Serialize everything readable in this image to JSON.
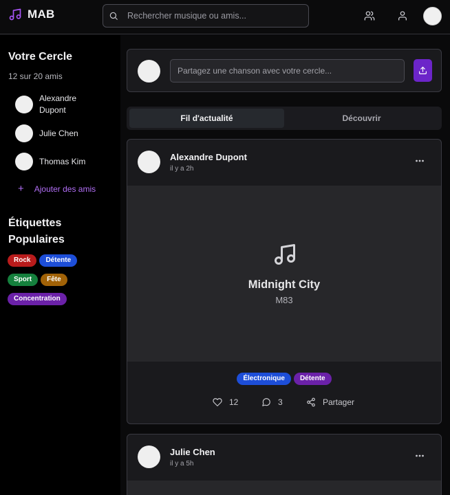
{
  "app": {
    "name": "MAB"
  },
  "search": {
    "placeholder": "Rechercher musique ou amis..."
  },
  "colors": {
    "accent": "#a855f7",
    "accent_button": "#6c25c9",
    "background": "#0a0a0b",
    "card": "#1a1a1d"
  },
  "header_icons": [
    "friends-icon",
    "profile-icon"
  ],
  "sidebar": {
    "circle_title": "Votre Cercle",
    "circle_count": "12 sur 20 amis",
    "friends": [
      {
        "name": "Alexandre Dupont"
      },
      {
        "name": "Julie Chen"
      },
      {
        "name": "Thomas Kim"
      }
    ],
    "add_friends": "Ajouter des amis",
    "tags_title_line1": "Étiquettes",
    "tags_title_line2": "Populaires",
    "tags": [
      {
        "label": "Rock",
        "color": "#b91c1c"
      },
      {
        "label": "Détente",
        "color": "#1d4ed8"
      },
      {
        "label": "Sport",
        "color": "#15803d"
      },
      {
        "label": "Fête",
        "color": "#a16207"
      },
      {
        "label": "Concentration",
        "color": "#6b21a8"
      }
    ]
  },
  "composer": {
    "placeholder": "Partagez une chanson avec votre cercle..."
  },
  "tabs": [
    {
      "label": "Fil d'actualité",
      "active": true
    },
    {
      "label": "Découvrir",
      "active": false
    }
  ],
  "posts": [
    {
      "author": "Alexandre Dupont",
      "time": "il y a 2h",
      "song_title": "Midnight City",
      "artist": "M83",
      "tags": [
        {
          "label": "Électronique",
          "color": "#1d4ed8"
        },
        {
          "label": "Détente",
          "color": "#6b21a8"
        }
      ],
      "likes": "12",
      "comments": "3",
      "share_label": "Partager"
    },
    {
      "author": "Julie Chen",
      "time": "il y a 5h"
    }
  ]
}
